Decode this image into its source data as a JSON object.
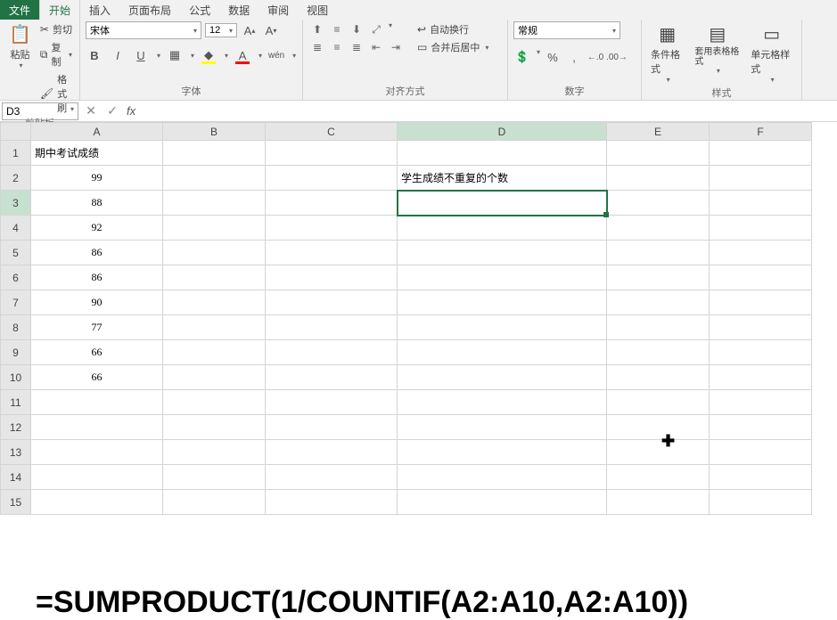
{
  "tabs": {
    "file": "文件",
    "home": "开始",
    "insert": "插入",
    "layout": "页面布局",
    "formula": "公式",
    "data": "数据",
    "review": "审阅",
    "view": "视图"
  },
  "ribbon": {
    "clipboard": {
      "label": "剪贴板",
      "paste": "粘贴",
      "cut": "剪切",
      "copy": "复制",
      "format_painter": "格式刷"
    },
    "font": {
      "label": "字体",
      "name": "宋体",
      "size": "12",
      "bold": "B",
      "italic": "I",
      "underline": "U",
      "ruby": "wén"
    },
    "alignment": {
      "label": "对齐方式",
      "wrap": "自动换行",
      "merge": "合并后居中"
    },
    "number": {
      "label": "数字",
      "format": "常规",
      "decrease": ".0",
      "increase": ".00"
    },
    "styles": {
      "label": "样式",
      "cond": "条件格式",
      "table": "套用表格格式",
      "cell": "单元格样式"
    }
  },
  "namebox": {
    "ref": "D3"
  },
  "formula_bar": {
    "value": ""
  },
  "columns": [
    "A",
    "B",
    "C",
    "D",
    "E",
    "F"
  ],
  "rows": [
    1,
    2,
    3,
    4,
    5,
    6,
    7,
    8,
    9,
    10,
    11,
    12,
    13,
    14,
    15
  ],
  "cells": {
    "A1": "期中考试成绩",
    "A2": "99",
    "A3": "88",
    "A4": "92",
    "A5": "86",
    "A6": "86",
    "A7": "90",
    "A8": "77",
    "A9": "66",
    "A10": "66",
    "D2": "学生成绩不重复的个数"
  },
  "overlay_formula": "=SUMPRODUCT(1/COUNTIF(A2:A10,A2:A10))",
  "active_cell": "D3"
}
